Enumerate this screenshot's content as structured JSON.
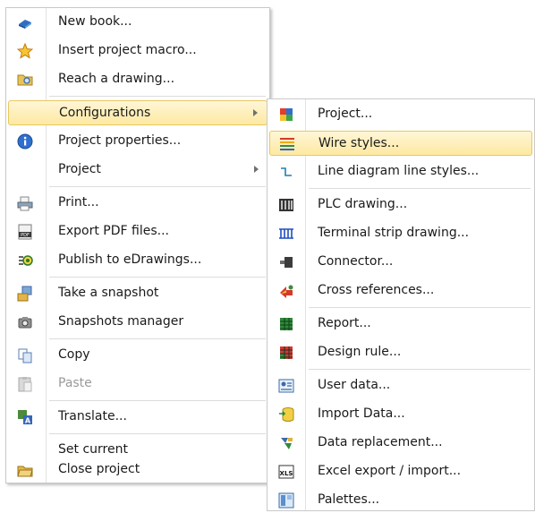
{
  "main_menu": {
    "items": [
      {
        "label": "New book...",
        "icon": "blue-book-icon"
      },
      {
        "label": "Insert project macro...",
        "icon": "star-icon"
      },
      {
        "label": "Reach a drawing...",
        "icon": "folder-search-icon"
      },
      {
        "label": "Configurations",
        "icon": "",
        "submenu": true,
        "state": "highlighted"
      },
      {
        "label": "Project properties...",
        "icon": "info-icon"
      },
      {
        "label": "Project",
        "icon": "",
        "submenu": true
      },
      {
        "label": "Print...",
        "icon": "printer-icon"
      },
      {
        "label": "Export PDF files...",
        "icon": "pdf-icon"
      },
      {
        "label": "Publish to eDrawings...",
        "icon": "edrawings-icon"
      },
      {
        "label": "Take a snapshot",
        "icon": "snapshot-icon"
      },
      {
        "label": "Snapshots manager",
        "icon": "camera-icon"
      },
      {
        "label": "Copy",
        "icon": "copy-icon"
      },
      {
        "label": "Paste",
        "icon": "paste-icon",
        "state": "disabled"
      },
      {
        "label": "Translate...",
        "icon": "translate-icon"
      },
      {
        "label": "Set current",
        "icon": ""
      },
      {
        "label": "Close project",
        "icon": "close-project-icon"
      }
    ]
  },
  "sub_menu": {
    "items": [
      {
        "label": "Project...",
        "icon": "project-cube-icon"
      },
      {
        "label": "Wire styles...",
        "icon": "wire-styles-icon",
        "state": "highlighted"
      },
      {
        "label": "Line diagram line styles...",
        "icon": "line-style-icon"
      },
      {
        "label": "PLC drawing...",
        "icon": "plc-icon"
      },
      {
        "label": "Terminal strip drawing...",
        "icon": "terminal-strip-icon"
      },
      {
        "label": "Connector...",
        "icon": "connector-icon"
      },
      {
        "label": "Cross references...",
        "icon": "cross-references-icon"
      },
      {
        "label": "Report...",
        "icon": "report-table-icon"
      },
      {
        "label": "Design rule...",
        "icon": "design-rule-icon"
      },
      {
        "label": "User data...",
        "icon": "user-data-icon"
      },
      {
        "label": "Import Data...",
        "icon": "import-data-icon"
      },
      {
        "label": "Data replacement...",
        "icon": "data-replacement-icon"
      },
      {
        "label": "Excel export / import...",
        "icon": "excel-icon"
      },
      {
        "label": "Palettes...",
        "icon": "palettes-icon"
      }
    ]
  },
  "colors": {
    "highlight": "#fde9a2",
    "highlight_border": "#e8c85f",
    "disabled_text": "#9a9a9a"
  }
}
